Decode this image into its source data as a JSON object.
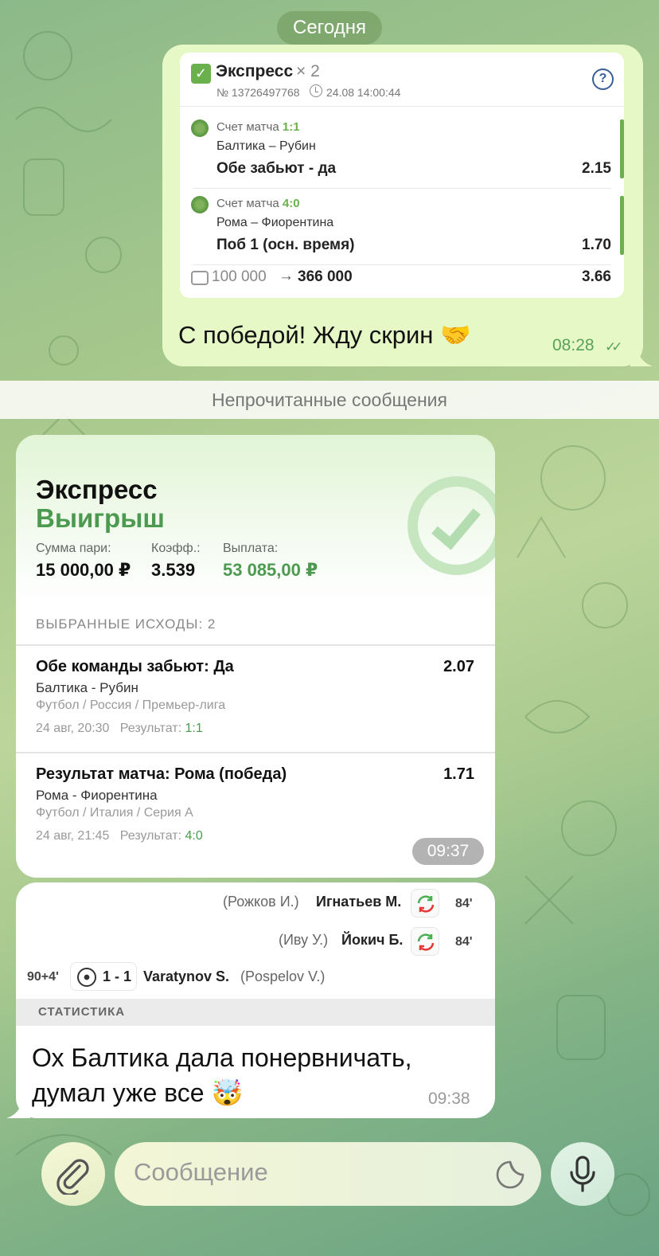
{
  "date_label": "Сегодня",
  "outgoing": {
    "bet": {
      "title": "Экспресс",
      "multiplier": "× 2",
      "number": "№ 13726497768",
      "datetime": "24.08 14:00:44",
      "legs": [
        {
          "score_label": "Счет матча",
          "score": "1:1",
          "teams": "Балтика – Рубин",
          "pick": "Обе забьют - да",
          "odd": "2.15"
        },
        {
          "score_label": "Счет матча",
          "score": "4:0",
          "teams": "Рома – Фиорентина",
          "pick": "Поб 1 (осн. время)",
          "odd": "1.70"
        }
      ],
      "stake": "100 000",
      "arrow": "→",
      "payout": "366 000",
      "total_odd": "3.66"
    },
    "text": "С победой! Жду скрин 🤝",
    "time": "08:28",
    "ticks": "✓✓"
  },
  "unread_label": "Непрочитанные сообщения",
  "incoming1": {
    "title": "Экспресс",
    "status": "Выигрыш",
    "stake_label": "Сумма пари:",
    "stake": "15 000,00 ₽",
    "coef_label": "Коэфф.:",
    "coef": "3.539",
    "payout_label": "Выплата:",
    "payout": "53 085,00 ₽",
    "selected_label": "ВЫБРАННЫЕ ИСХОДЫ: 2",
    "events": [
      {
        "name": "Обе команды забьют: Да",
        "odd": "2.07",
        "teams": "Балтика - Рубин",
        "league": "Футбол / Россия / Премьер-лига",
        "when": "24 авг, 20:30",
        "result_label": "Результат:",
        "result": "1:1"
      },
      {
        "name": "Результат матча: Рома (победа)",
        "odd": "1.71",
        "teams": "Рома - Фиорентина",
        "league": "Футбол / Италия / Серия А",
        "when": "24 авг, 21:45",
        "result_label": "Результат:",
        "result": "4:0"
      }
    ],
    "time": "09:37"
  },
  "incoming2": {
    "subs": [
      {
        "out": "(Рожков И.)",
        "in": "Игнатьев М.",
        "minute": "84'"
      },
      {
        "out": "(Иву У.)",
        "in": "Йокич Б.",
        "minute": "84'"
      }
    ],
    "goal": {
      "minute": "90+4'",
      "score": "1 - 1",
      "scorer": "Varatynov S.",
      "assist": "(Pospelov V.)"
    },
    "stats_label": "СТАТИСТИКА",
    "text": "Ох Балтика дала понервничать, думал уже все 🤯",
    "time": "09:38"
  },
  "composer": {
    "placeholder": "Сообщение",
    "attach_icon": "paperclip-icon",
    "sticker_icon": "sticker-icon",
    "mic_icon": "microphone-icon"
  }
}
